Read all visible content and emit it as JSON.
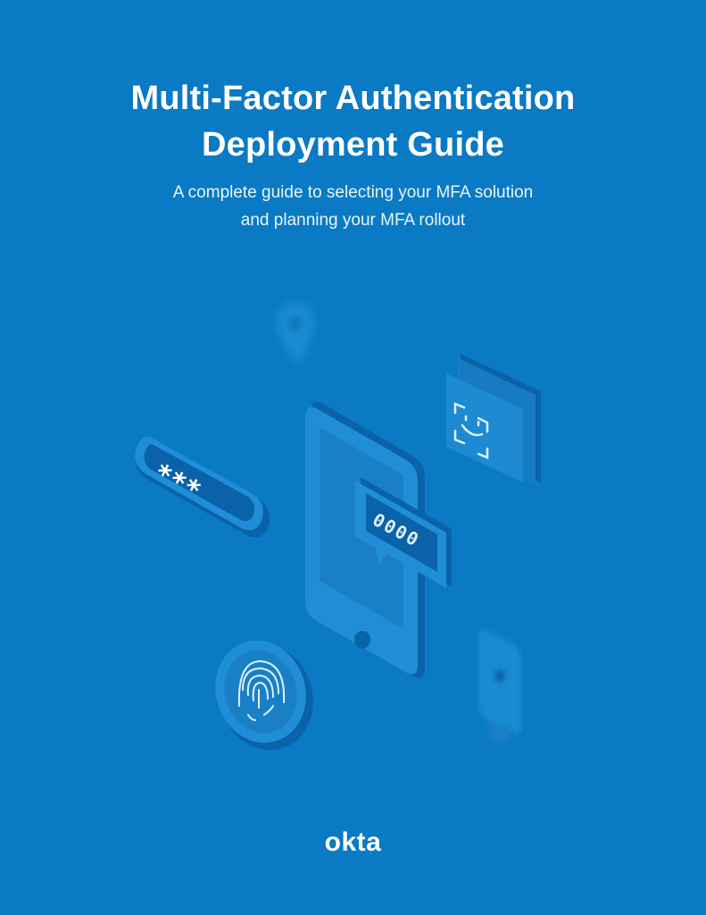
{
  "document": {
    "title_line1": "Multi-Factor Authentication",
    "title_line2": "Deployment Guide",
    "subtitle_line1": "A complete guide to selecting your MFA solution",
    "subtitle_line2": "and planning your MFA rollout",
    "logo_text": "okta"
  },
  "illustration": {
    "password_field": {
      "text": "***",
      "icon": "password-field-icon"
    },
    "sms_code": {
      "text": "0000",
      "icon": "message-code-icon"
    },
    "icons": [
      "location-pin-icon",
      "face-id-icon",
      "smartphone-icon",
      "fingerprint-icon",
      "security-key-icon"
    ]
  },
  "colors": {
    "background": "#0a7ac4",
    "shape_light": "#1f8ed6",
    "shape_mid": "#1a80c6",
    "shape_dark": "#0a62a8",
    "glyph": "#dff1ff"
  }
}
